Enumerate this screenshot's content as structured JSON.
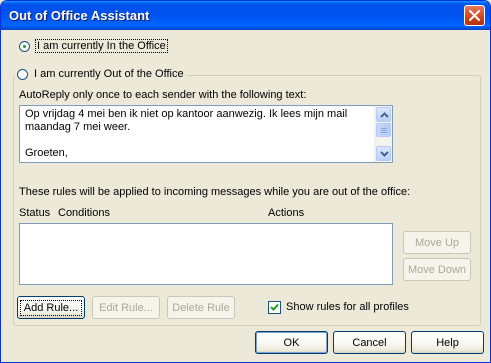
{
  "window": {
    "title": "Out of Office Assistant"
  },
  "status_options": {
    "in_office": {
      "label": "I am currently In the Office",
      "selected": true
    },
    "out_of_office": {
      "label": "I am currently Out of the Office",
      "selected": false
    }
  },
  "autoreply": {
    "label": "AutoReply only once to each sender with the following text:",
    "text": "Op vrijdag 4 mei ben ik niet op kantoor aanwezig. Ik lees mijn mail maandag 7 mei weer.\n\nGroeten,"
  },
  "rules": {
    "description": "These rules will be applied to incoming messages while you are out of the office:",
    "columns": {
      "status": "Status",
      "conditions": "Conditions",
      "actions": "Actions"
    },
    "rows": []
  },
  "buttons": {
    "move_up": "Move Up",
    "move_down": "Move Down",
    "add_rule": "Add Rule...",
    "edit_rule": "Edit Rule...",
    "delete_rule": "Delete Rule",
    "ok": "OK",
    "cancel": "Cancel",
    "help": "Help"
  },
  "show_all_profiles": {
    "label": "Show rules for all profiles",
    "checked": true
  },
  "colors": {
    "titlebar": "#0054e3",
    "dialog_bg": "#ece9d8",
    "close_button": "#d2421c",
    "input_border": "#7f9db9",
    "radio_dot": "#21a121"
  }
}
